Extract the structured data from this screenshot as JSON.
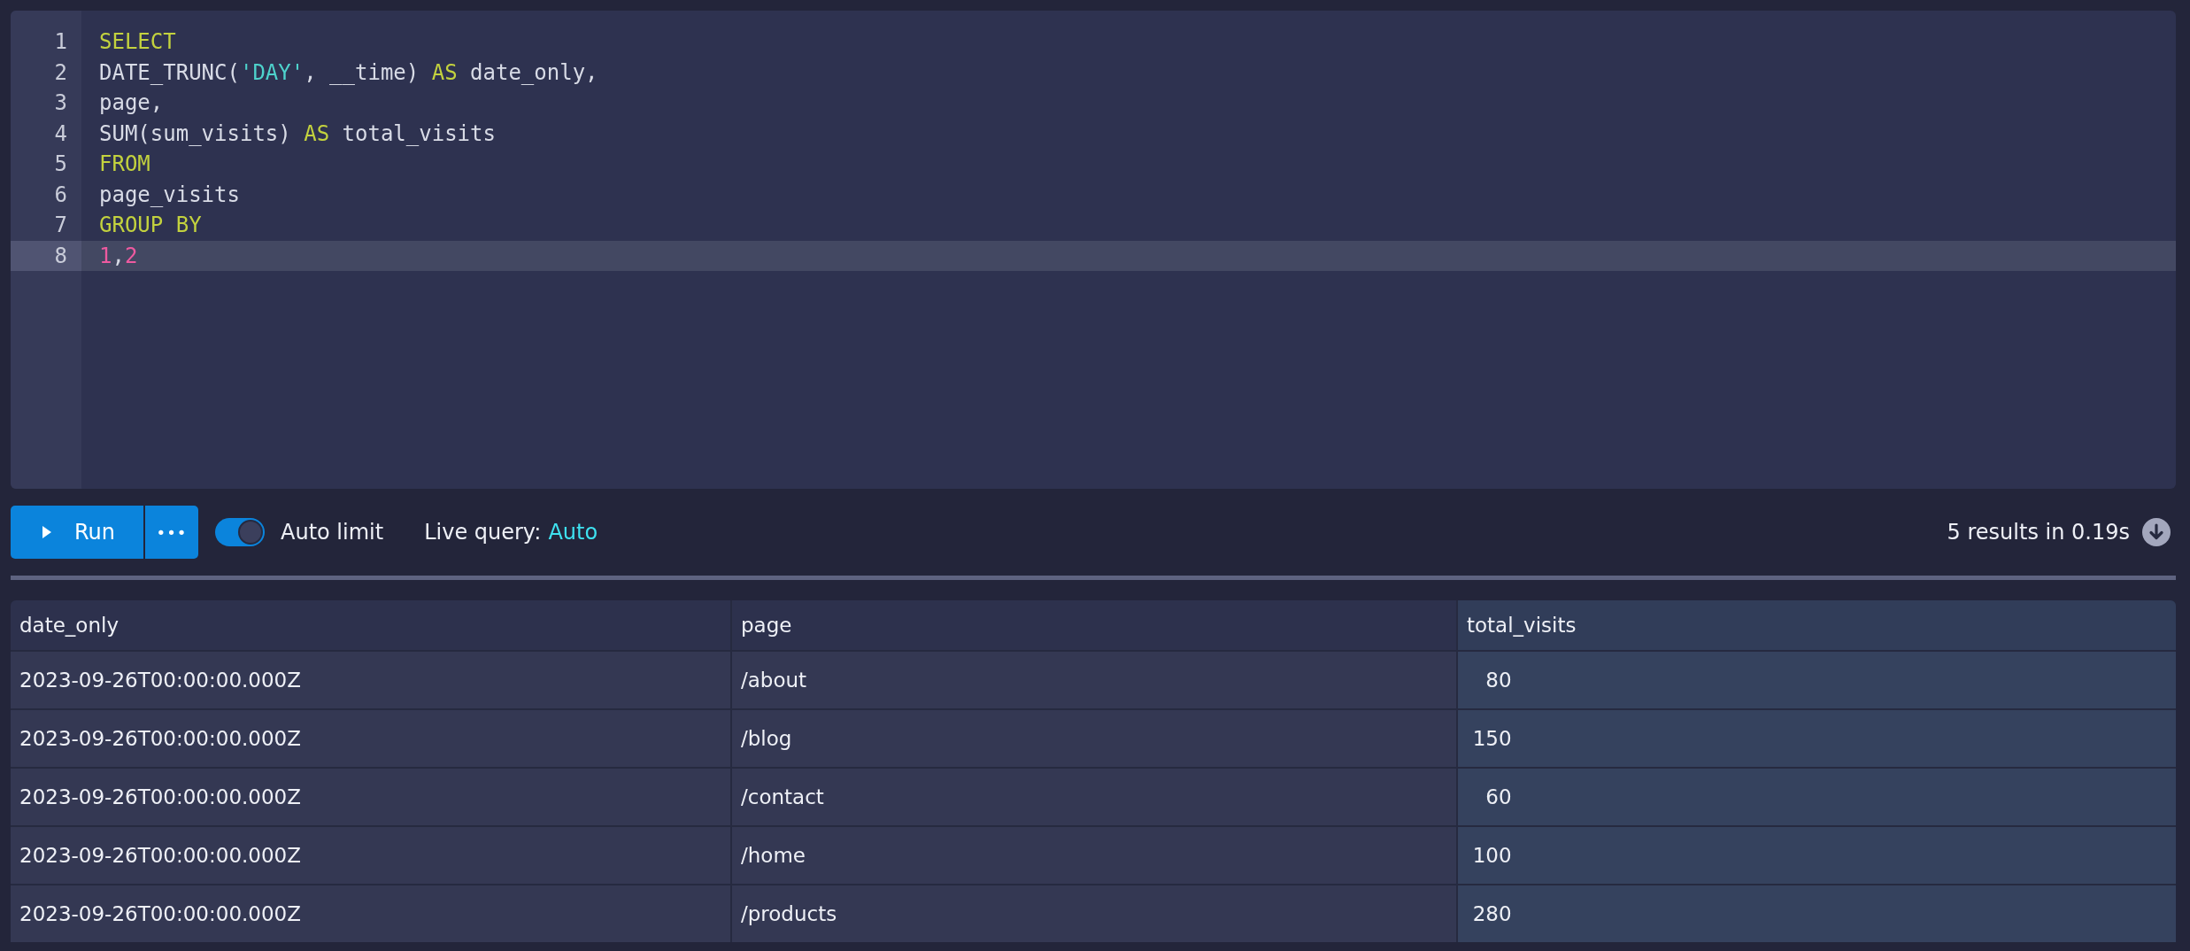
{
  "editor": {
    "lines": [
      {
        "number": "1",
        "active": false,
        "tokens": [
          {
            "kind": "keyword",
            "text": "SELECT"
          }
        ]
      },
      {
        "number": "2",
        "active": false,
        "tokens": [
          {
            "kind": "plain",
            "text": "DATE_TRUNC("
          },
          {
            "kind": "string",
            "text": "'DAY'"
          },
          {
            "kind": "plain",
            "text": ", __time) "
          },
          {
            "kind": "keyword",
            "text": "AS"
          },
          {
            "kind": "plain",
            "text": " date_only,"
          }
        ]
      },
      {
        "number": "3",
        "active": false,
        "tokens": [
          {
            "kind": "plain",
            "text": "page,"
          }
        ]
      },
      {
        "number": "4",
        "active": false,
        "tokens": [
          {
            "kind": "plain",
            "text": "SUM(sum_visits) "
          },
          {
            "kind": "keyword",
            "text": "AS"
          },
          {
            "kind": "plain",
            "text": " total_visits"
          }
        ]
      },
      {
        "number": "5",
        "active": false,
        "tokens": [
          {
            "kind": "keyword",
            "text": "FROM"
          }
        ]
      },
      {
        "number": "6",
        "active": false,
        "tokens": [
          {
            "kind": "plain",
            "text": "page_visits"
          }
        ]
      },
      {
        "number": "7",
        "active": false,
        "tokens": [
          {
            "kind": "keyword",
            "text": "GROUP BY"
          }
        ]
      },
      {
        "number": "8",
        "active": true,
        "tokens": [
          {
            "kind": "number",
            "text": "1"
          },
          {
            "kind": "plain",
            "text": ","
          },
          {
            "kind": "number",
            "text": "2"
          }
        ]
      }
    ]
  },
  "toolbar": {
    "run_button": {
      "label": "Run"
    },
    "more_button": {
      "label": "•••"
    },
    "auto_limit": {
      "label": "Auto limit",
      "on": true
    },
    "live_query": {
      "label": "Live query:",
      "value": "Auto"
    },
    "result_summary": "5 results in 0.19s"
  },
  "table": {
    "columns": [
      {
        "label": "date_only",
        "selected": false
      },
      {
        "label": "page",
        "selected": false
      },
      {
        "label": "total_visits",
        "selected": true
      }
    ],
    "rows": [
      [
        "2023-09-26T00:00:00.000Z",
        "/about",
        "80"
      ],
      [
        "2023-09-26T00:00:00.000Z",
        "/blog",
        "150"
      ],
      [
        "2023-09-26T00:00:00.000Z",
        "/contact",
        "60"
      ],
      [
        "2023-09-26T00:00:00.000Z",
        "/home",
        "100"
      ],
      [
        "2023-09-26T00:00:00.000Z",
        "/products",
        "280"
      ]
    ]
  }
}
